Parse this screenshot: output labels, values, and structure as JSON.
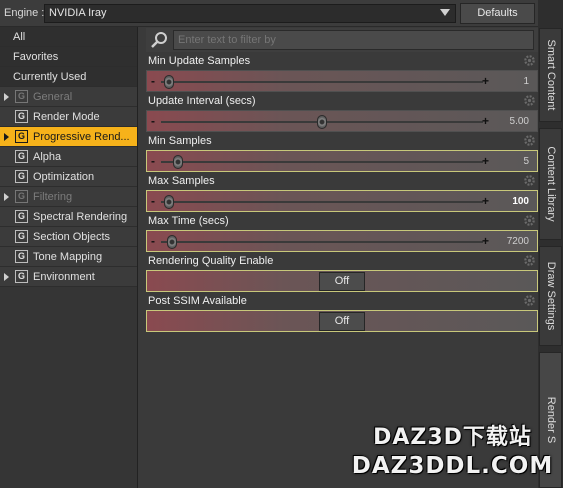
{
  "engine": {
    "label": "Engine :",
    "value": "NVIDIA Iray",
    "defaults_label": "Defaults"
  },
  "filter": {
    "placeholder": "Enter text to filter by"
  },
  "nav": {
    "all": "All",
    "favorites": "Favorites",
    "currently_used": "Currently Used",
    "categories": [
      {
        "label": "General",
        "disabled": true,
        "expandable": true,
        "selected": false
      },
      {
        "label": "Render Mode",
        "disabled": false,
        "expandable": false,
        "selected": false
      },
      {
        "label": "Progressive Rend...",
        "disabled": false,
        "expandable": true,
        "selected": true
      },
      {
        "label": "Alpha",
        "disabled": false,
        "expandable": false,
        "selected": false
      },
      {
        "label": "Optimization",
        "disabled": false,
        "expandable": false,
        "selected": false
      },
      {
        "label": "Filtering",
        "disabled": true,
        "expandable": true,
        "selected": false
      },
      {
        "label": "Spectral Rendering",
        "disabled": false,
        "expandable": false,
        "selected": false
      },
      {
        "label": "Section Objects",
        "disabled": false,
        "expandable": false,
        "selected": false
      },
      {
        "label": "Tone Mapping",
        "disabled": false,
        "expandable": false,
        "selected": false
      },
      {
        "label": "Environment",
        "disabled": false,
        "expandable": true,
        "selected": false
      }
    ],
    "group_glyph": "G"
  },
  "properties": [
    {
      "label": "Min Update Samples",
      "type": "slider",
      "value": "1",
      "fraction": 0.01,
      "bold": false
    },
    {
      "label": "Update Interval (secs)",
      "type": "slider",
      "value": "5.00",
      "fraction": 0.5,
      "bold": false
    },
    {
      "label": "Min Samples",
      "type": "slider",
      "value": "5",
      "fraction": 0.04,
      "bold": false
    },
    {
      "label": "Max Samples",
      "type": "slider",
      "value": "100",
      "fraction": 0.01,
      "bold": true
    },
    {
      "label": "Max Time (secs)",
      "type": "slider",
      "value": "7200",
      "fraction": 0.02,
      "bold": false
    },
    {
      "label": "Rendering Quality Enable",
      "type": "toggle",
      "value": "Off"
    },
    {
      "label": "Post SSIM Available",
      "type": "toggle",
      "value": "Off"
    }
  ],
  "right_tabs": [
    "Smart Content",
    "Content Library",
    "Draw Settings",
    "Render S"
  ],
  "watermark": {
    "line1": "DAZ3D下载站",
    "line2": "DAZ3DDL.COM"
  },
  "colors": {
    "accent": "#f6b21a",
    "field_tint": "#8a4a50"
  }
}
